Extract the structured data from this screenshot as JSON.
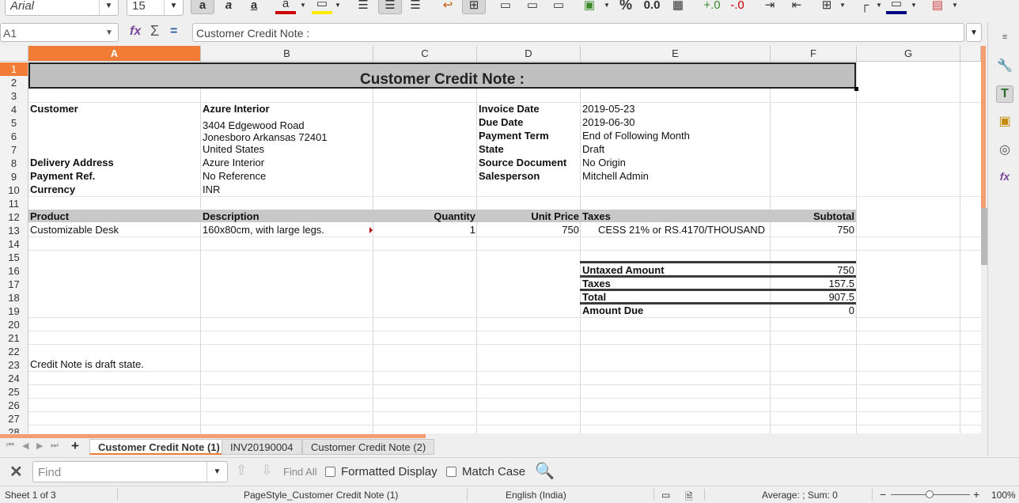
{
  "toolbar": {
    "font_name": "Arial",
    "font_size": "15",
    "percent_label": "%",
    "decimal_label": "0.0"
  },
  "formula_bar": {
    "cell_ref": "A1",
    "content": "Customer Credit Note :"
  },
  "columns": [
    "A",
    "B",
    "C",
    "D",
    "E",
    "F",
    "G"
  ],
  "selected_column": "A",
  "selected_row": "1",
  "rows": [
    "1",
    "2",
    "3",
    "4",
    "5",
    "6",
    "7",
    "8",
    "9",
    "10",
    "11",
    "12",
    "13",
    "14",
    "15",
    "16",
    "17",
    "18",
    "19",
    "20",
    "21",
    "22",
    "23",
    "24",
    "25",
    "26",
    "27",
    "28"
  ],
  "sheet": {
    "title": "Customer Credit Note :",
    "customer_label": "Customer",
    "customer_value": "Azure Interior",
    "address_line1": "3404  Edgewood Road",
    "address_line2": "Jonesboro Arkansas 72401",
    "address_line3": "United States",
    "delivery_label": "Delivery Address",
    "delivery_value": "Azure Interior",
    "payment_ref_label": "Payment Ref.",
    "payment_ref_value": "No Reference",
    "currency_label": "Currency",
    "currency_value": "INR",
    "invoice_date_label": "Invoice Date",
    "invoice_date_value": "2019-05-23",
    "due_date_label": "Due Date",
    "due_date_value": "2019-06-30",
    "payment_term_label": "Payment Term",
    "payment_term_value": "End of Following Month",
    "state_label": "State",
    "state_value": "Draft",
    "source_doc_label": "Source Document",
    "source_doc_value": "No Origin",
    "salesperson_label": "Salesperson",
    "salesperson_value": "Mitchell Admin",
    "lines_header": {
      "product": "Product",
      "description": "Description",
      "quantity": "Quantity",
      "unit_price": "Unit Price",
      "taxes": "Taxes",
      "subtotal": "Subtotal"
    },
    "line": {
      "product": "Customizable Desk",
      "description": "160x80cm, with large legs.",
      "quantity": "1",
      "unit_price": "750",
      "taxes": "CESS 21% or RS.4170/THOUSAND",
      "subtotal": "750"
    },
    "totals": {
      "untaxed_label": "Untaxed Amount",
      "untaxed_value": "750",
      "taxes_label": "Taxes",
      "taxes_value": "157.5",
      "total_label": "Total",
      "total_value": "907.5",
      "due_label": "Amount Due",
      "due_value": "0"
    },
    "note": "Credit Note is draft state."
  },
  "tabs": [
    {
      "label": "Customer Credit Note (1)",
      "active": true
    },
    {
      "label": "INV20190004",
      "active": false
    },
    {
      "label": "Customer Credit Note (2)",
      "active": false
    }
  ],
  "findbar": {
    "placeholder": "Find",
    "find_all": "Find All",
    "formatted_display": "Formatted Display",
    "match_case": "Match Case"
  },
  "status": {
    "sheet_info": "Sheet 1 of 3",
    "page_style": "PageStyle_Customer Credit Note (1)",
    "language": "English (India)",
    "summary": "Average: ; Sum: 0",
    "zoom": "100%"
  },
  "colors": {
    "accent": "#f07c35",
    "header_band": "#c8c8c8",
    "title_fill": "#c0c0c0"
  }
}
